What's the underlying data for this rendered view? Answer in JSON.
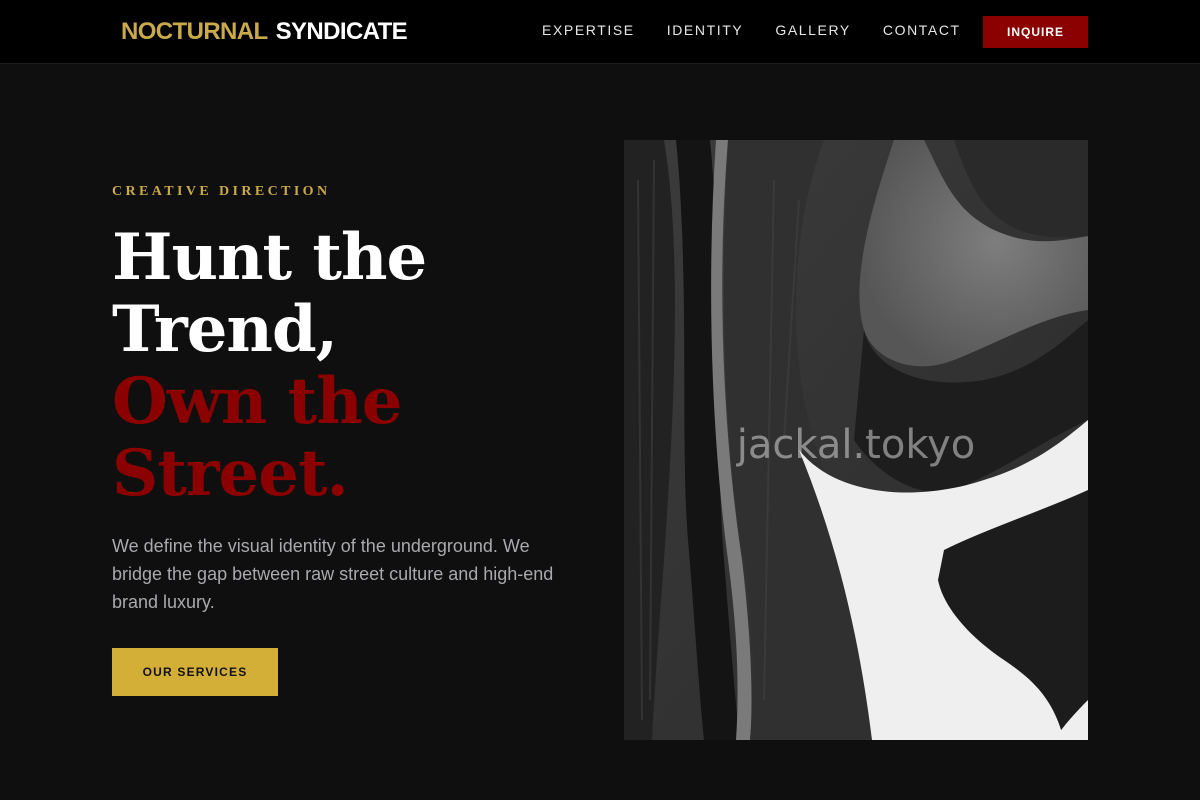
{
  "brand": {
    "name_first": "NOCTURNAL",
    "name_second": "SYNDICATE"
  },
  "nav": {
    "links": [
      "EXPERTISE",
      "IDENTITY",
      "GALLERY",
      "CONTACT"
    ],
    "cta_label": "INQUIRE"
  },
  "hero": {
    "eyebrow": "CREATIVE DIRECTION",
    "headline_white": [
      "Hunt the",
      "Trend,"
    ],
    "headline_red": [
      "Own the",
      "Street."
    ],
    "description": "We define the visual identity of the underground. We bridge the gap between raw street culture and high-end brand luxury.",
    "cta_label": "OUR SERVICES",
    "image_watermark": "jackal.tokyo",
    "image_alt": "abstract black and white brushstroke artwork"
  },
  "colors": {
    "background": "#0f0f10",
    "header": "#000000",
    "gold": "#c9a94a",
    "button_gold": "#d4af37",
    "red": "#8b0000",
    "text_muted": "#a9a9ae"
  },
  "icons": {
    "hero_image": "abstract-art-image"
  }
}
